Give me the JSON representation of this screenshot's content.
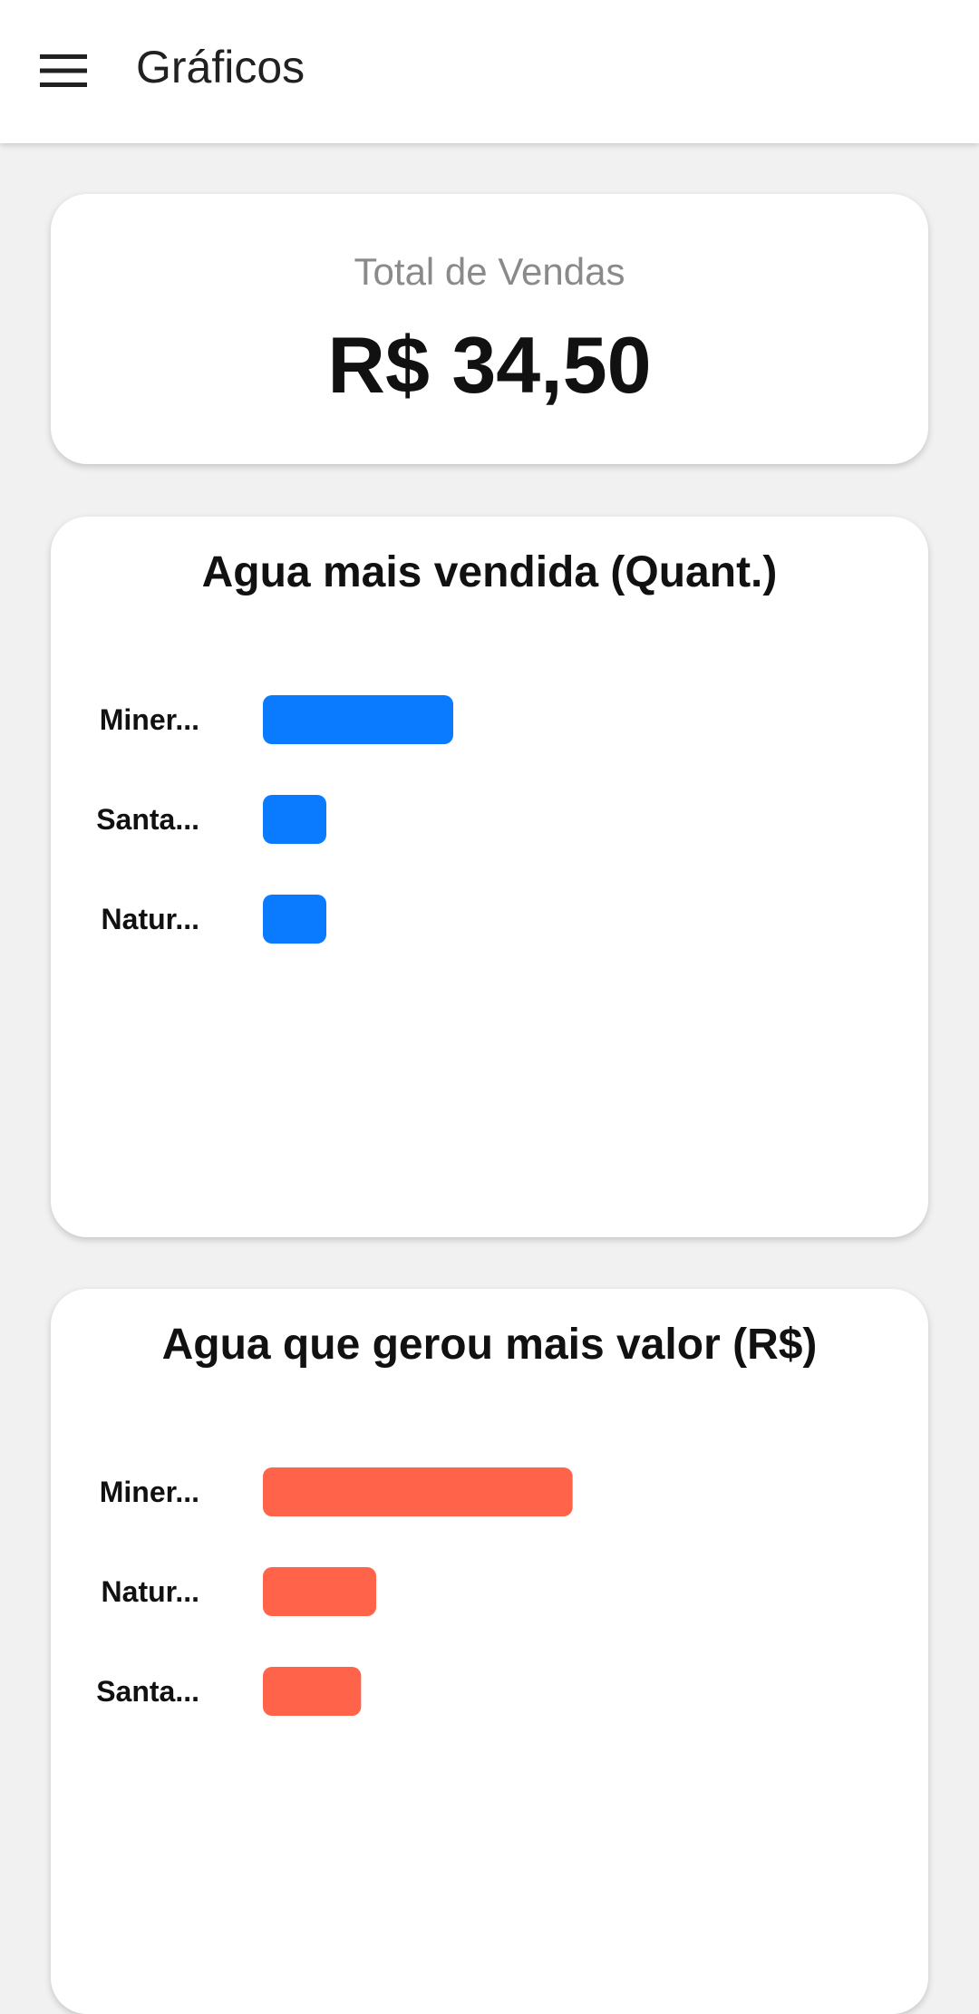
{
  "appbar": {
    "title": "Gráficos",
    "menu_icon": "hamburger-menu-icon"
  },
  "total": {
    "label": "Total de Vendas",
    "value": "R$ 34,50"
  },
  "colors": {
    "quantity_bar": "#0a7bff",
    "value_bar": "#ff634a"
  },
  "chart_data": [
    {
      "type": "bar",
      "orientation": "horizontal",
      "title": "Agua mais vendida (Quant.)",
      "categories": [
        "Miner...",
        "Santa...",
        "Natur..."
      ],
      "values": [
        3,
        1,
        1
      ],
      "xlim": [
        0,
        10
      ],
      "grid": false
    },
    {
      "type": "bar",
      "orientation": "horizontal",
      "title": "Agua que gerou mais valor (R$)",
      "categories": [
        "Miner...",
        "Natur...",
        "Santa..."
      ],
      "values": [
        20.5,
        7.5,
        6.5
      ],
      "xlim": [
        0,
        42
      ],
      "grid": false
    }
  ]
}
